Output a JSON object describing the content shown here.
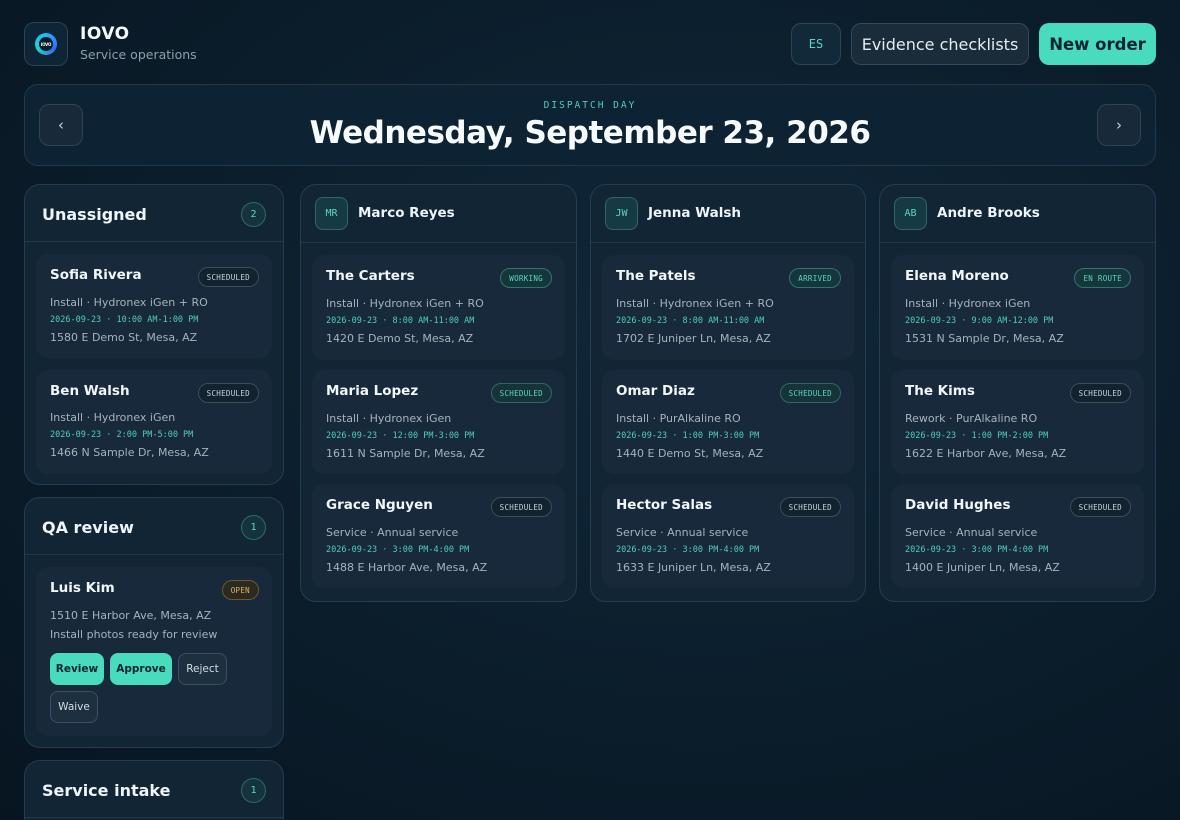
{
  "brand": {
    "name": "IOVO",
    "subtitle": "Service operations",
    "logo_text": "IOVO"
  },
  "header": {
    "lang_label": "ES",
    "evidence_label": "Evidence checklists",
    "new_order_label": "New order"
  },
  "date_banner": {
    "label": "DISPATCH DAY",
    "title": "Wednesday, September 23, 2026",
    "prev_icon": "‹",
    "next_icon": "›"
  },
  "unassigned": {
    "title": "Unassigned",
    "count": "2",
    "cards": [
      {
        "name": "Sofia Rivera",
        "status": "SCHEDULED",
        "service": "Install · Hydronex iGen + RO",
        "time": "2026-09-23 · 10:00 AM-1:00 PM",
        "address": "1580 E Demo St, Mesa, AZ"
      },
      {
        "name": "Ben Walsh",
        "status": "SCHEDULED",
        "service": "Install · Hydronex iGen",
        "time": "2026-09-23 · 2:00 PM-5:00 PM",
        "address": "1466 N Sample Dr, Mesa, AZ"
      }
    ]
  },
  "qa_review": {
    "title": "QA review",
    "count": "1",
    "card": {
      "name": "Luis Kim",
      "status": "OPEN",
      "address": "1510 E Harbor Ave, Mesa, AZ",
      "note": "Install photos ready for review",
      "actions": {
        "review": "Review",
        "approve": "Approve",
        "reject": "Reject",
        "waive": "Waive"
      }
    }
  },
  "service_intake": {
    "title": "Service intake",
    "count": "1"
  },
  "technicians": [
    {
      "initials": "MR",
      "name": "Marco Reyes",
      "cards": [
        {
          "name": "The Carters",
          "status": "WORKING",
          "service": "Install · Hydronex iGen + RO",
          "time": "2026-09-23 · 8:00 AM-11:00 AM",
          "address": "1420 E Demo St, Mesa, AZ"
        },
        {
          "name": "Maria Lopez",
          "status": "SCHEDULED",
          "service": "Install · Hydronex iGen",
          "time": "2026-09-23 · 12:00 PM-3:00 PM",
          "address": "1611 N Sample Dr, Mesa, AZ"
        },
        {
          "name": "Grace Nguyen",
          "status": "SCHEDULED",
          "service": "Service · Annual service",
          "time": "2026-09-23 · 3:00 PM-4:00 PM",
          "address": "1488 E Harbor Ave, Mesa, AZ"
        }
      ]
    },
    {
      "initials": "JW",
      "name": "Jenna Walsh",
      "cards": [
        {
          "name": "The Patels",
          "status": "ARRIVED",
          "service": "Install · Hydronex iGen + RO",
          "time": "2026-09-23 · 8:00 AM-11:00 AM",
          "address": "1702 E Juniper Ln, Mesa, AZ"
        },
        {
          "name": "Omar Diaz",
          "status": "SCHEDULED",
          "service": "Install · PurAlkaline RO",
          "time": "2026-09-23 · 1:00 PM-3:00 PM",
          "address": "1440 E Demo St, Mesa, AZ"
        },
        {
          "name": "Hector Salas",
          "status": "SCHEDULED",
          "service": "Service · Annual service",
          "time": "2026-09-23 · 3:00 PM-4:00 PM",
          "address": "1633 E Juniper Ln, Mesa, AZ"
        }
      ]
    },
    {
      "initials": "AB",
      "name": "Andre Brooks",
      "cards": [
        {
          "name": "Elena Moreno",
          "status": "EN ROUTE",
          "service": "Install · Hydronex iGen",
          "time": "2026-09-23 · 9:00 AM-12:00 PM",
          "address": "1531 N Sample Dr, Mesa, AZ"
        },
        {
          "name": "The Kims",
          "status": "SCHEDULED",
          "service": "Rework · PurAlkaline RO",
          "time": "2026-09-23 · 1:00 PM-2:00 PM",
          "address": "1622 E Harbor Ave, Mesa, AZ"
        },
        {
          "name": "David Hughes",
          "status": "SCHEDULED",
          "service": "Service · Annual service",
          "time": "2026-09-23 · 3:00 PM-4:00 PM",
          "address": "1400 E Juniper Ln, Mesa, AZ"
        }
      ]
    }
  ],
  "colors": {
    "accent": "#48dbbd",
    "background": "#0b1d2b",
    "open": "#e0b55a"
  }
}
